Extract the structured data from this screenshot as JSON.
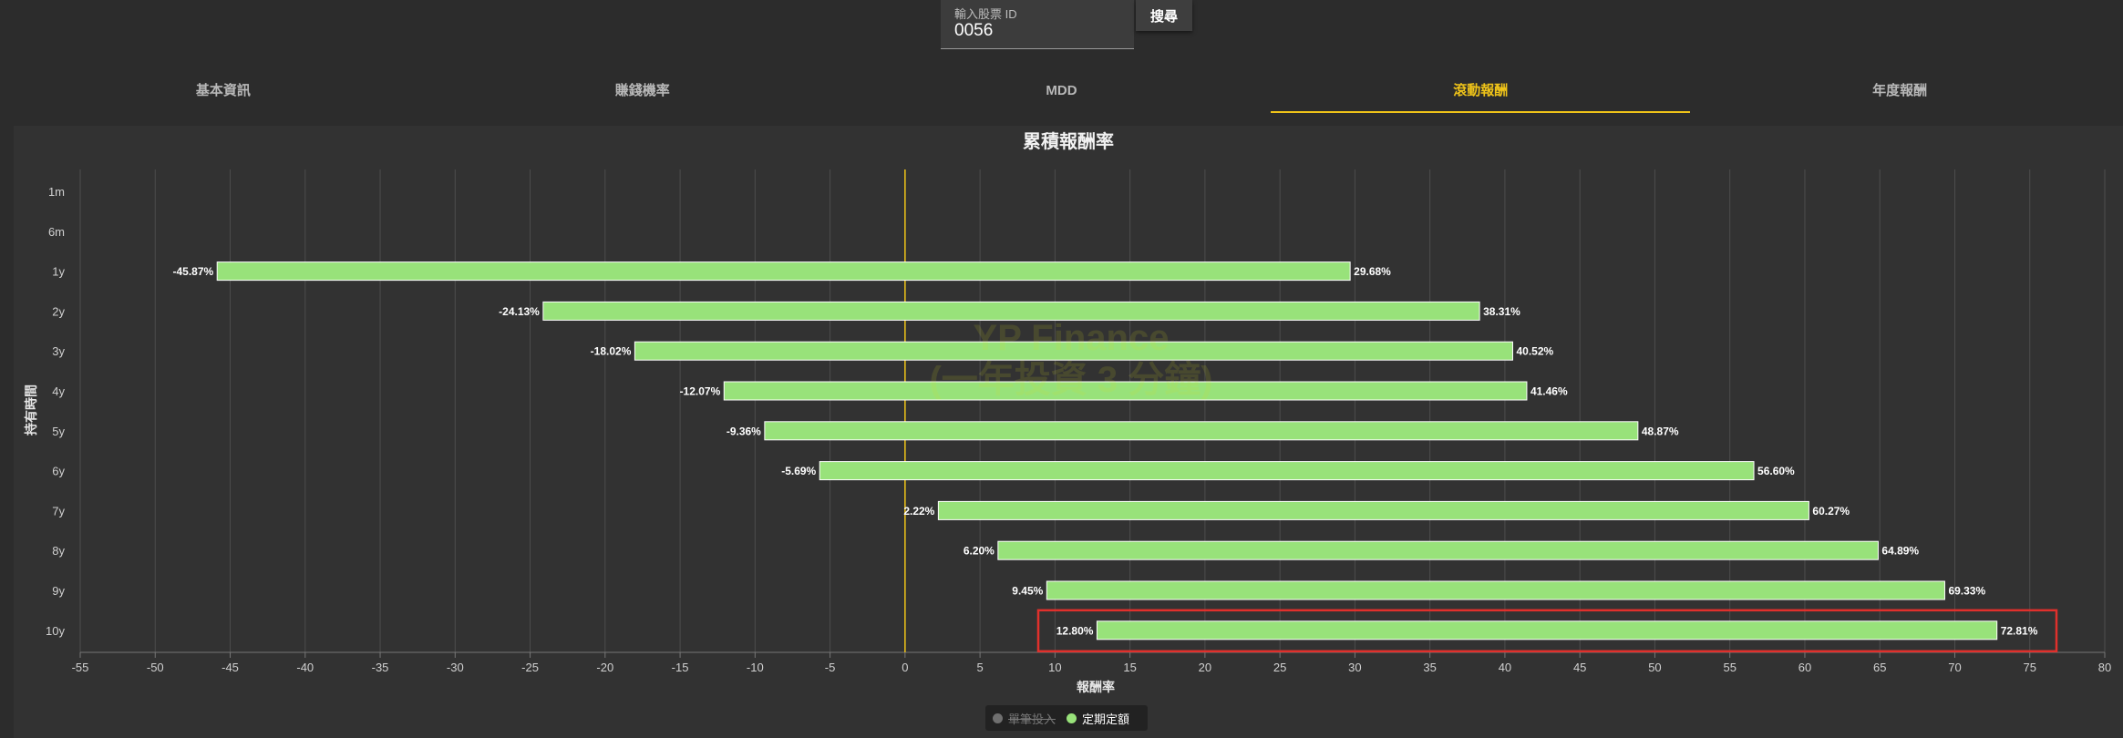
{
  "search": {
    "label": "輸入股票 ID",
    "value": "0056",
    "button": "搜尋"
  },
  "tabs": [
    {
      "label": "基本資訊",
      "active": false
    },
    {
      "label": "賺錢機率",
      "active": false
    },
    {
      "label": "MDD",
      "active": false
    },
    {
      "label": "滾動報酬",
      "active": true
    },
    {
      "label": "年度報酬",
      "active": false
    }
  ],
  "watermark": {
    "line1": "YP Finance",
    "line2": "(一年投資 3 分鐘)"
  },
  "legend": [
    {
      "label": "單筆投入",
      "color": "#6f6f6f",
      "enabled": false
    },
    {
      "label": "定期定額",
      "color": "#98e27a",
      "enabled": true
    }
  ],
  "chart_data": {
    "type": "bar",
    "orientation": "horizontal-range",
    "title": "累積報酬率",
    "xlabel": "報酬率",
    "ylabel": "持有時間",
    "categories": [
      "1m",
      "6m",
      "1y",
      "2y",
      "3y",
      "4y",
      "5y",
      "6y",
      "7y",
      "8y",
      "9y",
      "10y"
    ],
    "series": [
      {
        "name": "定期定額",
        "color": "#98e27a",
        "min_labels": [
          "",
          "",
          "-45.87%",
          "-24.13%",
          "-18.02%",
          "-12.07%",
          "-9.36%",
          "-5.69%",
          "2.22%",
          "6.20%",
          "9.45%",
          "12.80%"
        ],
        "max_labels": [
          "",
          "",
          "29.68%",
          "38.31%",
          "40.52%",
          "41.46%",
          "48.87%",
          "56.60%",
          "60.27%",
          "64.89%",
          "69.33%",
          "72.81%"
        ],
        "min": [
          null,
          null,
          -45.87,
          -24.13,
          -18.02,
          -12.07,
          -9.36,
          -5.69,
          2.22,
          6.2,
          9.45,
          12.8
        ],
        "max": [
          null,
          null,
          29.68,
          38.31,
          40.52,
          41.46,
          48.87,
          56.6,
          60.27,
          64.89,
          69.33,
          72.81
        ]
      }
    ],
    "xlim": [
      -55,
      80
    ],
    "xticks": [
      -55,
      -50,
      -45,
      -40,
      -35,
      -30,
      -25,
      -20,
      -15,
      -10,
      -5,
      0,
      5,
      10,
      15,
      20,
      25,
      30,
      35,
      40,
      45,
      50,
      55,
      60,
      65,
      70,
      75,
      80
    ],
    "grid": true,
    "zero_line_color": "#f0c419",
    "highlight_category": "10y",
    "highlight_color": "#e0302c",
    "legend_position": "bottom-center"
  }
}
